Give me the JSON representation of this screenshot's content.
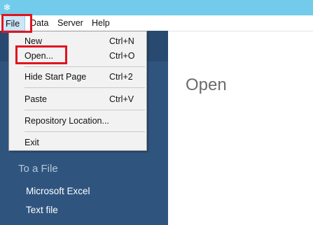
{
  "menubar": {
    "file": "File",
    "data": "Data",
    "server": "Server",
    "help": "Help"
  },
  "file_menu": {
    "items": [
      {
        "label": "New",
        "shortcut": "Ctrl+N"
      },
      {
        "label": "Open...",
        "shortcut": "Ctrl+O"
      },
      {
        "label": "Hide Start Page",
        "shortcut": "Ctrl+2"
      },
      {
        "label": "Paste",
        "shortcut": "Ctrl+V"
      },
      {
        "label": "Repository Location...",
        "shortcut": ""
      },
      {
        "label": "Exit",
        "shortcut": ""
      }
    ]
  },
  "sidebar": {
    "heading": "To a File",
    "links": [
      "Microsoft Excel",
      "Text file"
    ]
  },
  "main": {
    "title": "Open"
  },
  "colors": {
    "titlebar": "#72cbea",
    "sidebar": "#2f557f",
    "highlight": "#e1141f"
  },
  "icons": {
    "app": "snowflake-icon"
  }
}
